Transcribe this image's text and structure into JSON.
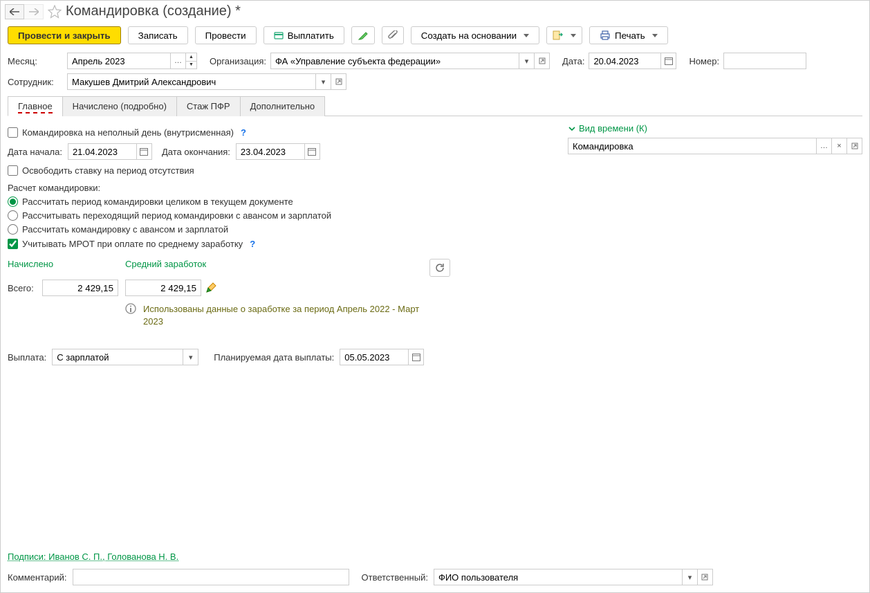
{
  "title": "Командировка (создание) *",
  "toolbar": {
    "post_close": "Провести и закрыть",
    "save": "Записать",
    "post": "Провести",
    "pay": "Выплатить",
    "create_based": "Создать на основании",
    "print": "Печать"
  },
  "header": {
    "month_label": "Месяц:",
    "month_value": "Апрель 2023",
    "org_label": "Организация:",
    "org_value": "ФА «Управление субъекта федерации»",
    "date_label": "Дата:",
    "date_value": "20.04.2023",
    "number_label": "Номер:",
    "number_value": "",
    "employee_label": "Сотрудник:",
    "employee_value": "Макушев Дмитрий Александрович"
  },
  "tabs": {
    "main": "Главное",
    "accrued_details": "Начислено (подробно)",
    "pfr": "Стаж ПФР",
    "additional": "Дополнительно"
  },
  "main": {
    "partial_day_label": "Командировка на неполный день (внутрисменная)",
    "start_label": "Дата начала:",
    "start_value": "21.04.2023",
    "end_label": "Дата окончания:",
    "end_value": "23.04.2023",
    "release_rate_label": "Освободить ставку на период отсутствия",
    "calc_section": "Расчет командировки:",
    "radio1": "Рассчитать период командировки целиком в текущем документе",
    "radio2": "Рассчитывать переходящий период командировки с авансом и зарплатой",
    "radio3": "Рассчитать командировку с авансом и зарплатой",
    "mrot_label": "Учитывать МРОТ при оплате по среднему заработку",
    "accrued_head": "Начислено",
    "avg_head": "Средний заработок",
    "total_label": "Всего:",
    "total_value": "2 429,15",
    "avg_value": "2 429,15",
    "info_text": "Использованы данные о заработке за период Апрель 2022 - Март 2023",
    "payout_label": "Выплата:",
    "payout_value": "С зарплатой",
    "planned_label": "Планируемая дата выплаты:",
    "planned_value": "05.05.2023"
  },
  "right": {
    "time_type_label": "Вид времени (К)",
    "time_type_value": "Командировка"
  },
  "footer": {
    "signatures": "Подписи: Иванов С. П., Голованова Н. В.",
    "comment_label": "Комментарий:",
    "comment_value": "",
    "responsible_label": "Ответственный:",
    "responsible_value": "ФИО пользователя"
  }
}
